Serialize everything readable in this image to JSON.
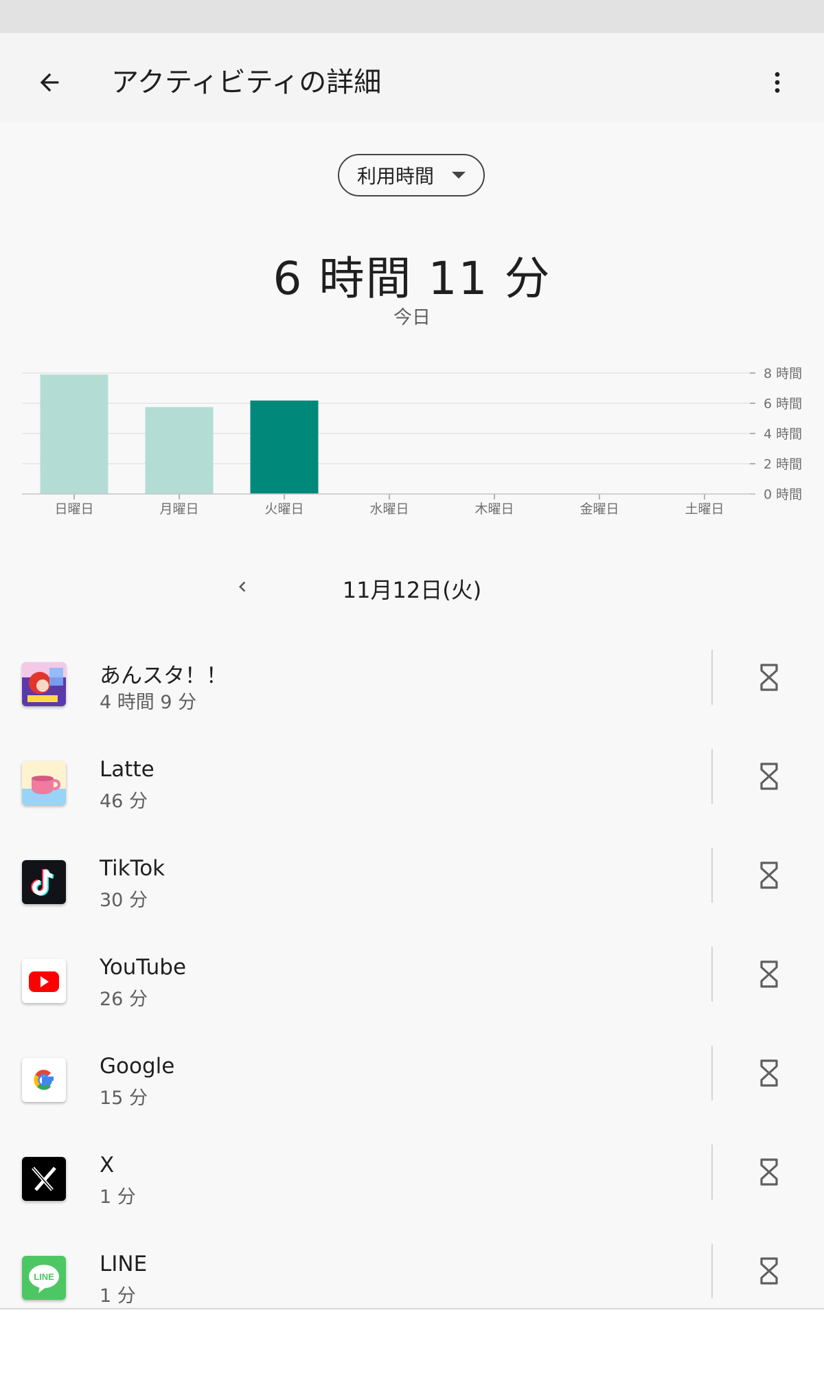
{
  "header": {
    "title": "アクティビティの詳細",
    "back_icon": "arrow-back-icon",
    "more_icon": "more-vert-icon"
  },
  "metric_selector": {
    "selected": "利用時間"
  },
  "summary": {
    "total": "6 時間 11 分",
    "period": "今日"
  },
  "chart_data": {
    "type": "bar",
    "categories": [
      "日曜日",
      "月曜日",
      "火曜日",
      "水曜日",
      "木曜日",
      "金曜日",
      "土曜日"
    ],
    "values": [
      7.9,
      5.75,
      6.18,
      0,
      0,
      0,
      0
    ],
    "selected_index": 2,
    "y_ticks": [
      {
        "value": 0,
        "label": "0 時間"
      },
      {
        "value": 2,
        "label": "2 時間"
      },
      {
        "value": 4,
        "label": "4 時間"
      },
      {
        "value": 6,
        "label": "6 時間"
      },
      {
        "value": 8,
        "label": "8 時間"
      }
    ],
    "ylim": [
      0,
      8
    ],
    "colors": {
      "normal": "#b3dcd5",
      "selected": "#00897b",
      "grid": "#e4e4e4",
      "label": "#6f6f6f"
    }
  },
  "date_nav": {
    "label": "11月12日(火)",
    "prev_icon": "chevron-left-icon"
  },
  "apps": [
    {
      "name": "あんスタ！！",
      "time": "4 時間 9 分",
      "icon": "ensemble-stars-icon"
    },
    {
      "name": "Latte",
      "time": "46 分",
      "icon": "latte-icon"
    },
    {
      "name": "TikTok",
      "time": "30 分",
      "icon": "tiktok-icon"
    },
    {
      "name": "YouTube",
      "time": "26 分",
      "icon": "youtube-icon"
    },
    {
      "name": "Google",
      "time": "15 分",
      "icon": "google-icon"
    },
    {
      "name": "X",
      "time": "1 分",
      "icon": "x-icon"
    },
    {
      "name": "LINE",
      "time": "1 分",
      "icon": "line-icon"
    }
  ],
  "line_icon_text": "LINE",
  "timer_icon": "hourglass-icon"
}
